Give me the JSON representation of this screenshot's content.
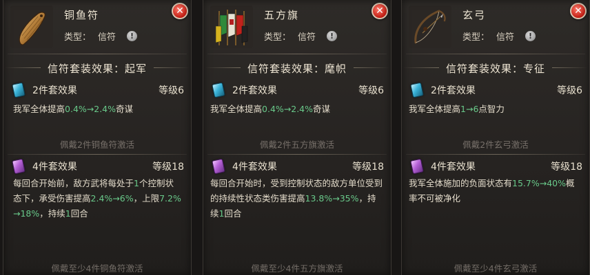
{
  "cards": [
    {
      "name": "铜鱼符",
      "type_label": "类型：",
      "type_value": "信符",
      "info_glyph": "!",
      "close_glyph": "✕",
      "icon": "bronze-fish-tally-icon",
      "set_title": "信符套装效果：起军",
      "tier2": {
        "label": "2件套效果",
        "level": "等级6",
        "desc": [
          {
            "t": "我军全体提高",
            "h": false
          },
          {
            "t": "0.4%→2.4%",
            "h": true
          },
          {
            "t": "奇谋",
            "h": false
          }
        ],
        "hint": "佩戴2件铜鱼符激活"
      },
      "tier4": {
        "label": "4件套效果",
        "level": "等级18",
        "desc": [
          {
            "t": "每回合开始前，敌方武将每处于",
            "h": false
          },
          {
            "t": "1",
            "h": true
          },
          {
            "t": "个控制状态下，承受伤害提高",
            "h": false
          },
          {
            "t": "2.4%→6%",
            "h": true
          },
          {
            "t": "，上限",
            "h": false
          },
          {
            "t": "7.2%→18%",
            "h": true
          },
          {
            "t": "，持续",
            "h": false
          },
          {
            "t": "1",
            "h": true
          },
          {
            "t": "回合",
            "h": false
          }
        ],
        "hint": "佩戴至少4件铜鱼符激活"
      }
    },
    {
      "name": "五方旗",
      "type_label": "类型：",
      "type_value": "信符",
      "info_glyph": "!",
      "close_glyph": "✕",
      "icon": "five-direction-flags-icon",
      "set_title": "信符套装效果：麾帜",
      "tier2": {
        "label": "2件套效果",
        "level": "等级6",
        "desc": [
          {
            "t": "我军全体提高",
            "h": false
          },
          {
            "t": "0.4%→2.4%",
            "h": true
          },
          {
            "t": "奇谋",
            "h": false
          }
        ],
        "hint": "佩戴2件五方旗激活"
      },
      "tier4": {
        "label": "4件套效果",
        "level": "等级18",
        "desc": [
          {
            "t": "每回合开始时，受到控制状态的敌方单位受到的持续性状态类伤害提高",
            "h": false
          },
          {
            "t": "13.8%→35%",
            "h": true
          },
          {
            "t": "，持续",
            "h": false
          },
          {
            "t": "1",
            "h": true
          },
          {
            "t": "回合",
            "h": false
          }
        ],
        "hint": "佩戴至少4件五方旗激活"
      }
    },
    {
      "name": "玄弓",
      "type_label": "类型：",
      "type_value": "信符",
      "info_glyph": "!",
      "close_glyph": "✕",
      "icon": "dark-bow-icon",
      "set_title": "信符套装效果：专征",
      "tier2": {
        "label": "2件套效果",
        "level": "等级6",
        "desc": [
          {
            "t": "我军全体提高",
            "h": false
          },
          {
            "t": "1→6",
            "h": true
          },
          {
            "t": "点智力",
            "h": false
          }
        ],
        "hint": "佩戴2件玄弓激活"
      },
      "tier4": {
        "label": "4件套效果",
        "level": "等级18",
        "desc": [
          {
            "t": "我军全体施加的负面状态有",
            "h": false
          },
          {
            "t": "15.7%→40%",
            "h": true
          },
          {
            "t": "概率不可被净化",
            "h": false
          }
        ],
        "hint": "佩戴至少4件玄弓激活"
      }
    }
  ]
}
